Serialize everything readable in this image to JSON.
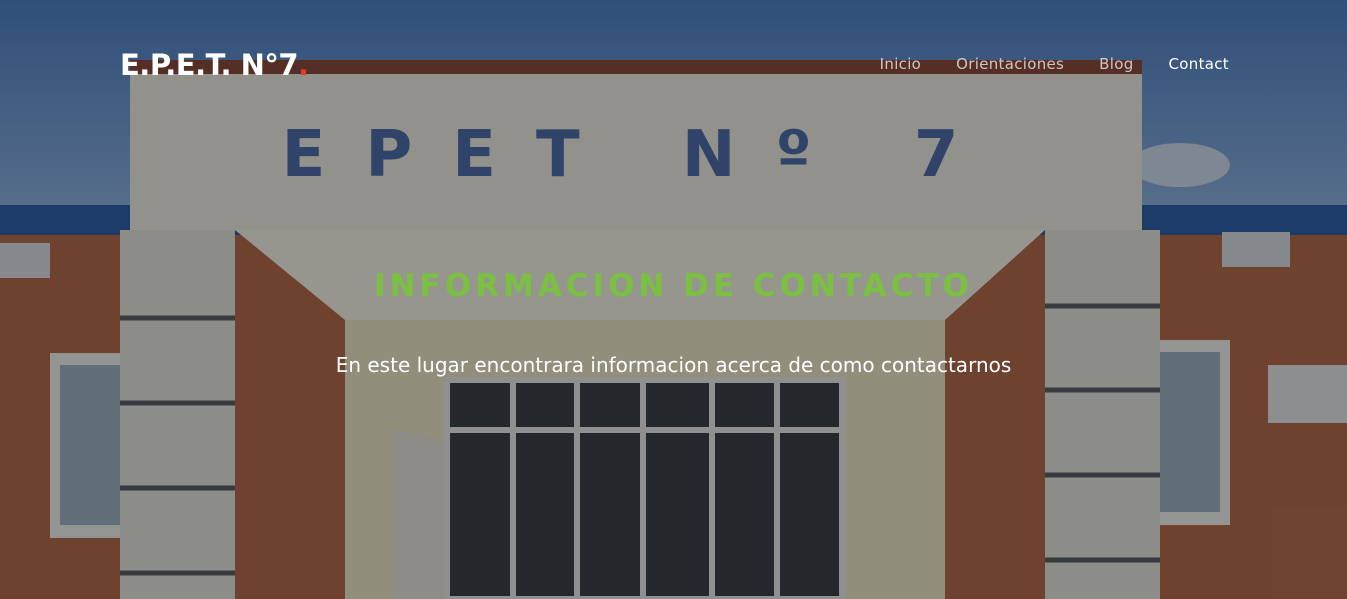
{
  "brand": {
    "name": "E.P.E.T. N°7",
    "dot": "."
  },
  "nav": {
    "items": [
      {
        "label": "Inicio",
        "active": false
      },
      {
        "label": "Orientaciones",
        "active": false
      },
      {
        "label": "Blog",
        "active": false
      },
      {
        "label": "Contact",
        "active": true
      }
    ]
  },
  "hero": {
    "title": "INFORMACION DE CONTACTO",
    "subtitle": "En este lugar encontrara informacion acerca de como contactarnos",
    "background_sign_text": "EPET Nº 7"
  },
  "colors": {
    "accent_green": "#7ac142",
    "brand_dot_red": "#e53935",
    "text_white": "#ffffff"
  }
}
